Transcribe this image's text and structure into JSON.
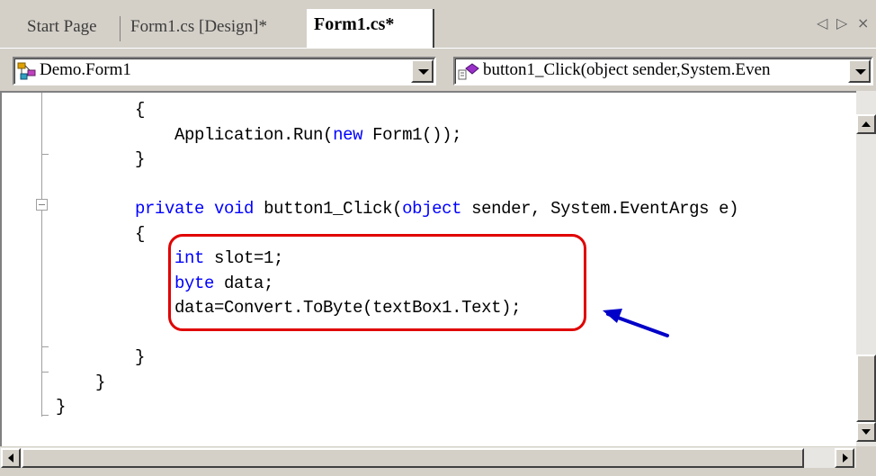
{
  "tabs": [
    {
      "label": "Start Page",
      "active": false
    },
    {
      "label": "Form1.cs [Design]*",
      "active": false
    },
    {
      "label": "Form1.cs*",
      "active": true
    }
  ],
  "tab_nav": {
    "prev": "◁",
    "next": "▷",
    "close": "×"
  },
  "class_dropdown": {
    "icon": "class-icon",
    "value": "Demo.Form1"
  },
  "member_dropdown": {
    "icon": "method-icon",
    "value": "button1_Click(object sender,System.Even"
  },
  "code": {
    "lines": [
      {
        "indent": "        ",
        "parts": [
          {
            "t": "{",
            "k": false
          }
        ]
      },
      {
        "indent": "            ",
        "parts": [
          {
            "t": "Application.Run(",
            "k": false
          },
          {
            "t": "new",
            "k": true
          },
          {
            "t": " Form1());",
            "k": false
          }
        ]
      },
      {
        "indent": "        ",
        "parts": [
          {
            "t": "}",
            "k": false
          }
        ]
      },
      {
        "indent": "",
        "parts": []
      },
      {
        "indent": "        ",
        "parts": [
          {
            "t": "private",
            "k": true
          },
          {
            "t": " ",
            "k": false
          },
          {
            "t": "void",
            "k": true
          },
          {
            "t": " button1_Click(",
            "k": false
          },
          {
            "t": "object",
            "k": true
          },
          {
            "t": " sender, System.EventArgs e)",
            "k": false
          }
        ]
      },
      {
        "indent": "        ",
        "parts": [
          {
            "t": "{",
            "k": false
          }
        ]
      },
      {
        "indent": "            ",
        "parts": [
          {
            "t": "int",
            "k": true
          },
          {
            "t": " slot=1;",
            "k": false
          }
        ]
      },
      {
        "indent": "            ",
        "parts": [
          {
            "t": "byte",
            "k": true
          },
          {
            "t": " data;",
            "k": false
          }
        ]
      },
      {
        "indent": "            ",
        "parts": [
          {
            "t": "data=Convert.ToByte(textBox1.Text);",
            "k": false
          }
        ]
      },
      {
        "indent": "",
        "parts": []
      },
      {
        "indent": "        ",
        "parts": [
          {
            "t": "}",
            "k": false
          }
        ]
      },
      {
        "indent": "    ",
        "parts": [
          {
            "t": "}",
            "k": false
          }
        ]
      },
      {
        "indent": "",
        "parts": [
          {
            "t": "}",
            "k": false
          }
        ]
      }
    ]
  },
  "colors": {
    "keyword": "#0000ff",
    "highlight": "#e00000",
    "annotation_arrow": "#0000c8"
  }
}
